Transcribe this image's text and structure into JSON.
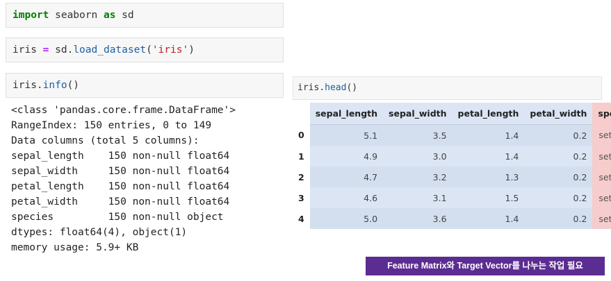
{
  "cells": {
    "import": {
      "kw1": "import",
      "mod": " seaborn ",
      "kw2": "as",
      "alias": " sd"
    },
    "load": {
      "var": "iris ",
      "eq": "=",
      "mid": " sd.",
      "func": "load_dataset",
      "open": "(",
      "arg": "'iris'",
      "close": ")"
    },
    "info": {
      "var": "iris.",
      "func": "info",
      "paren": "()"
    },
    "head": {
      "var": "iris.",
      "func": "head",
      "paren": "()"
    }
  },
  "info_output": [
    "<class 'pandas.core.frame.DataFrame'>",
    "RangeIndex: 150 entries, 0 to 149",
    "Data columns (total 5 columns):",
    "sepal_length    150 non-null float64",
    "sepal_width     150 non-null float64",
    "petal_length    150 non-null float64",
    "petal_width     150 non-null float64",
    "species         150 non-null object",
    "dtypes: float64(4), object(1)",
    "memory usage: 5.9+ KB"
  ],
  "table": {
    "columns": [
      "sepal_length",
      "sepal_width",
      "petal_length",
      "petal_width",
      "species"
    ],
    "rows": [
      {
        "index": "0",
        "values": [
          "5.1",
          "3.5",
          "1.4",
          "0.2",
          "setosa"
        ]
      },
      {
        "index": "1",
        "values": [
          "4.9",
          "3.0",
          "1.4",
          "0.2",
          "setosa"
        ]
      },
      {
        "index": "2",
        "values": [
          "4.7",
          "3.2",
          "1.3",
          "0.2",
          "setosa"
        ]
      },
      {
        "index": "3",
        "values": [
          "4.6",
          "3.1",
          "1.5",
          "0.2",
          "setosa"
        ]
      },
      {
        "index": "4",
        "values": [
          "5.0",
          "3.6",
          "1.4",
          "0.2",
          "setosa"
        ]
      }
    ]
  },
  "badge": {
    "text": "Feature Matrix와 Target Vector를 나누는 작업 필요"
  },
  "colors": {
    "feature_highlight": "#dbe5f4",
    "target_highlight": "#f7cccc",
    "badge_bg": "#5b2c91"
  }
}
